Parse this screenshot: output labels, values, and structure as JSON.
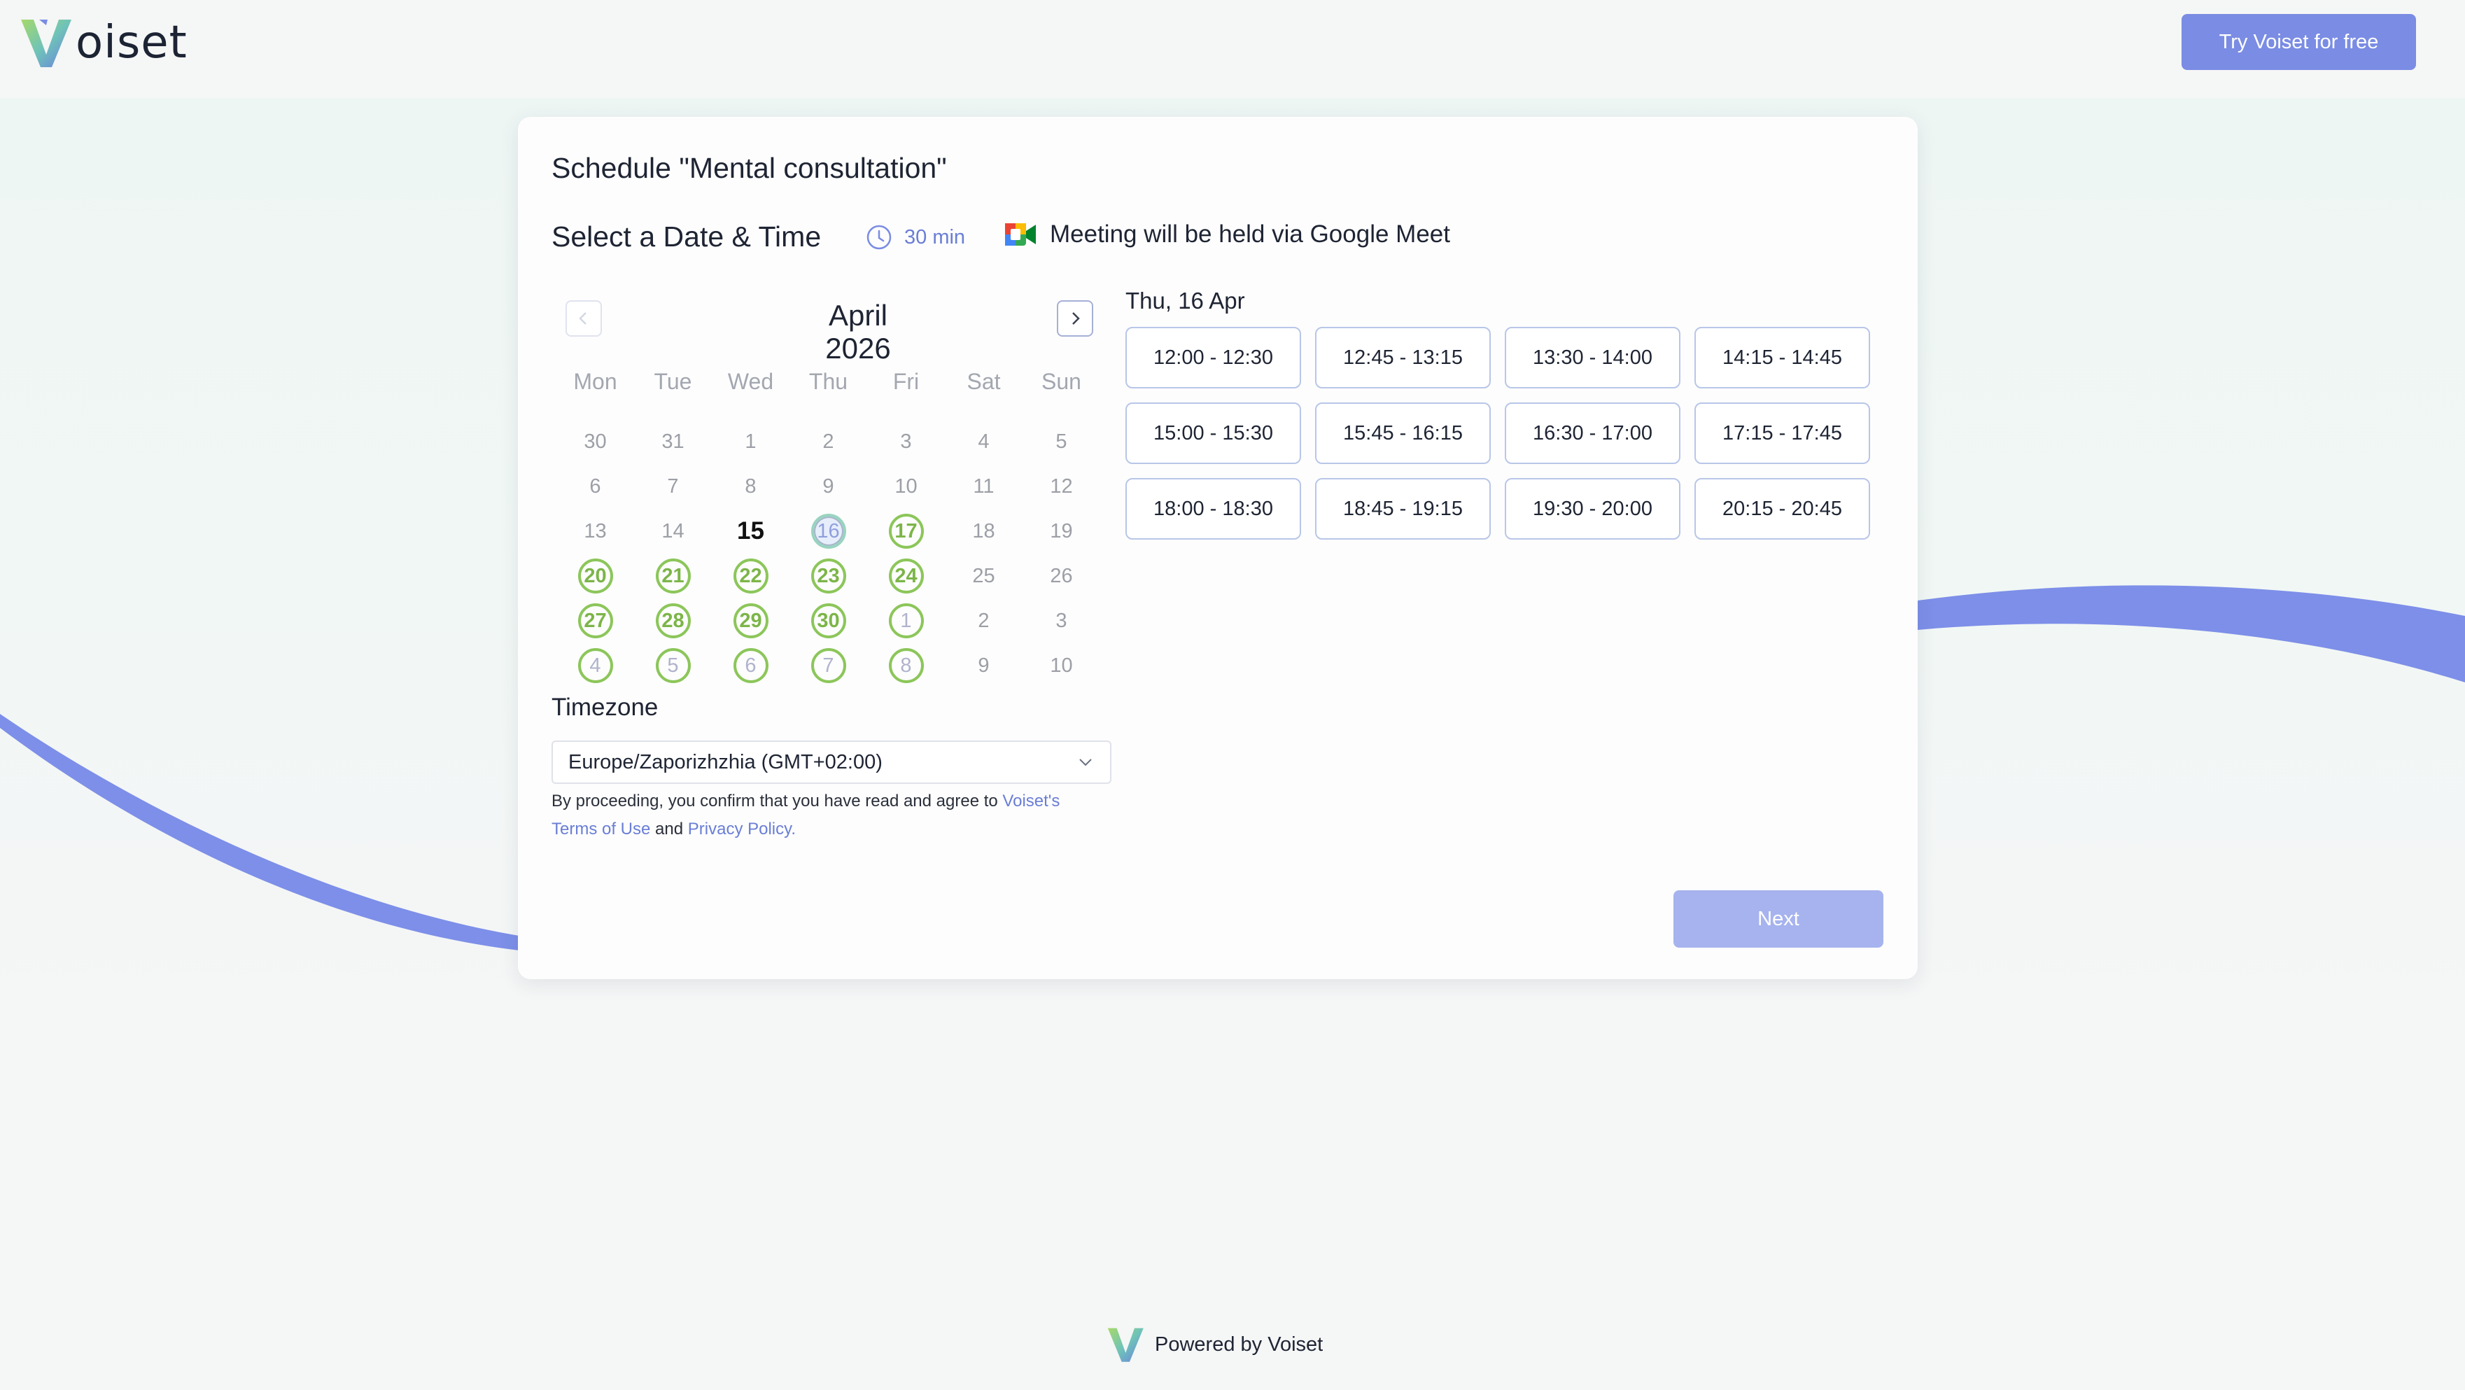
{
  "header": {
    "logo_text": "oiset",
    "try_button": "Try Voiset for free"
  },
  "card": {
    "title": "Schedule \"Mental consultation\"",
    "section_title": "Select a Date & Time",
    "duration": "30 min",
    "meeting_info": "Meeting will be held via Google Meet"
  },
  "calendar": {
    "month": "April",
    "year": "2026",
    "weekdays": [
      "Mon",
      "Tue",
      "Wed",
      "Thu",
      "Fri",
      "Sat",
      "Sun"
    ],
    "weeks": [
      [
        {
          "d": "30",
          "s": "off"
        },
        {
          "d": "31",
          "s": "off"
        },
        {
          "d": "1",
          "s": "off"
        },
        {
          "d": "2",
          "s": "off"
        },
        {
          "d": "3",
          "s": "off"
        },
        {
          "d": "4",
          "s": "off"
        },
        {
          "d": "5",
          "s": "off"
        }
      ],
      [
        {
          "d": "6",
          "s": "off"
        },
        {
          "d": "7",
          "s": "off"
        },
        {
          "d": "8",
          "s": "off"
        },
        {
          "d": "9",
          "s": "off"
        },
        {
          "d": "10",
          "s": "off"
        },
        {
          "d": "11",
          "s": "off"
        },
        {
          "d": "12",
          "s": "off"
        }
      ],
      [
        {
          "d": "13",
          "s": "off"
        },
        {
          "d": "14",
          "s": "off"
        },
        {
          "d": "15",
          "s": "today"
        },
        {
          "d": "16",
          "s": "selected"
        },
        {
          "d": "17",
          "s": "avail"
        },
        {
          "d": "18",
          "s": "off"
        },
        {
          "d": "19",
          "s": "off"
        }
      ],
      [
        {
          "d": "20",
          "s": "avail"
        },
        {
          "d": "21",
          "s": "avail"
        },
        {
          "d": "22",
          "s": "avail"
        },
        {
          "d": "23",
          "s": "avail"
        },
        {
          "d": "24",
          "s": "avail"
        },
        {
          "d": "25",
          "s": "off"
        },
        {
          "d": "26",
          "s": "off"
        }
      ],
      [
        {
          "d": "27",
          "s": "avail"
        },
        {
          "d": "28",
          "s": "avail"
        },
        {
          "d": "29",
          "s": "avail"
        },
        {
          "d": "30",
          "s": "avail"
        },
        {
          "d": "1",
          "s": "next"
        },
        {
          "d": "2",
          "s": "off"
        },
        {
          "d": "3",
          "s": "off"
        }
      ],
      [
        {
          "d": "4",
          "s": "next"
        },
        {
          "d": "5",
          "s": "next"
        },
        {
          "d": "6",
          "s": "next"
        },
        {
          "d": "7",
          "s": "next"
        },
        {
          "d": "8",
          "s": "next"
        },
        {
          "d": "9",
          "s": "off"
        },
        {
          "d": "10",
          "s": "off"
        }
      ]
    ]
  },
  "timezone": {
    "label": "Timezone",
    "value": "Europe/Zaporizhzhia (GMT+02:00)"
  },
  "consent": {
    "text": "By proceeding, you confirm that you have read and agree to ",
    "voiset_link": "Voiset's",
    "terms_link": "Terms of Use",
    "and": " and ",
    "privacy_link": "Privacy Policy."
  },
  "slots": {
    "date": "Thu, 16 Apr",
    "times": [
      "12:00 - 12:30",
      "12:45 - 13:15",
      "13:30 - 14:00",
      "14:15 - 14:45",
      "15:00 - 15:30",
      "15:45 - 16:15",
      "16:30 - 17:00",
      "17:15 - 17:45",
      "18:00 - 18:30",
      "18:45 - 19:15",
      "19:30 - 20:00",
      "20:15 - 20:45"
    ]
  },
  "actions": {
    "next": "Next"
  },
  "footer": {
    "powered_by": "Powered by Voiset"
  },
  "colors": {
    "accent": "#7a8ce3",
    "available": "#8cc65a",
    "wave": "#7d8fe8"
  }
}
